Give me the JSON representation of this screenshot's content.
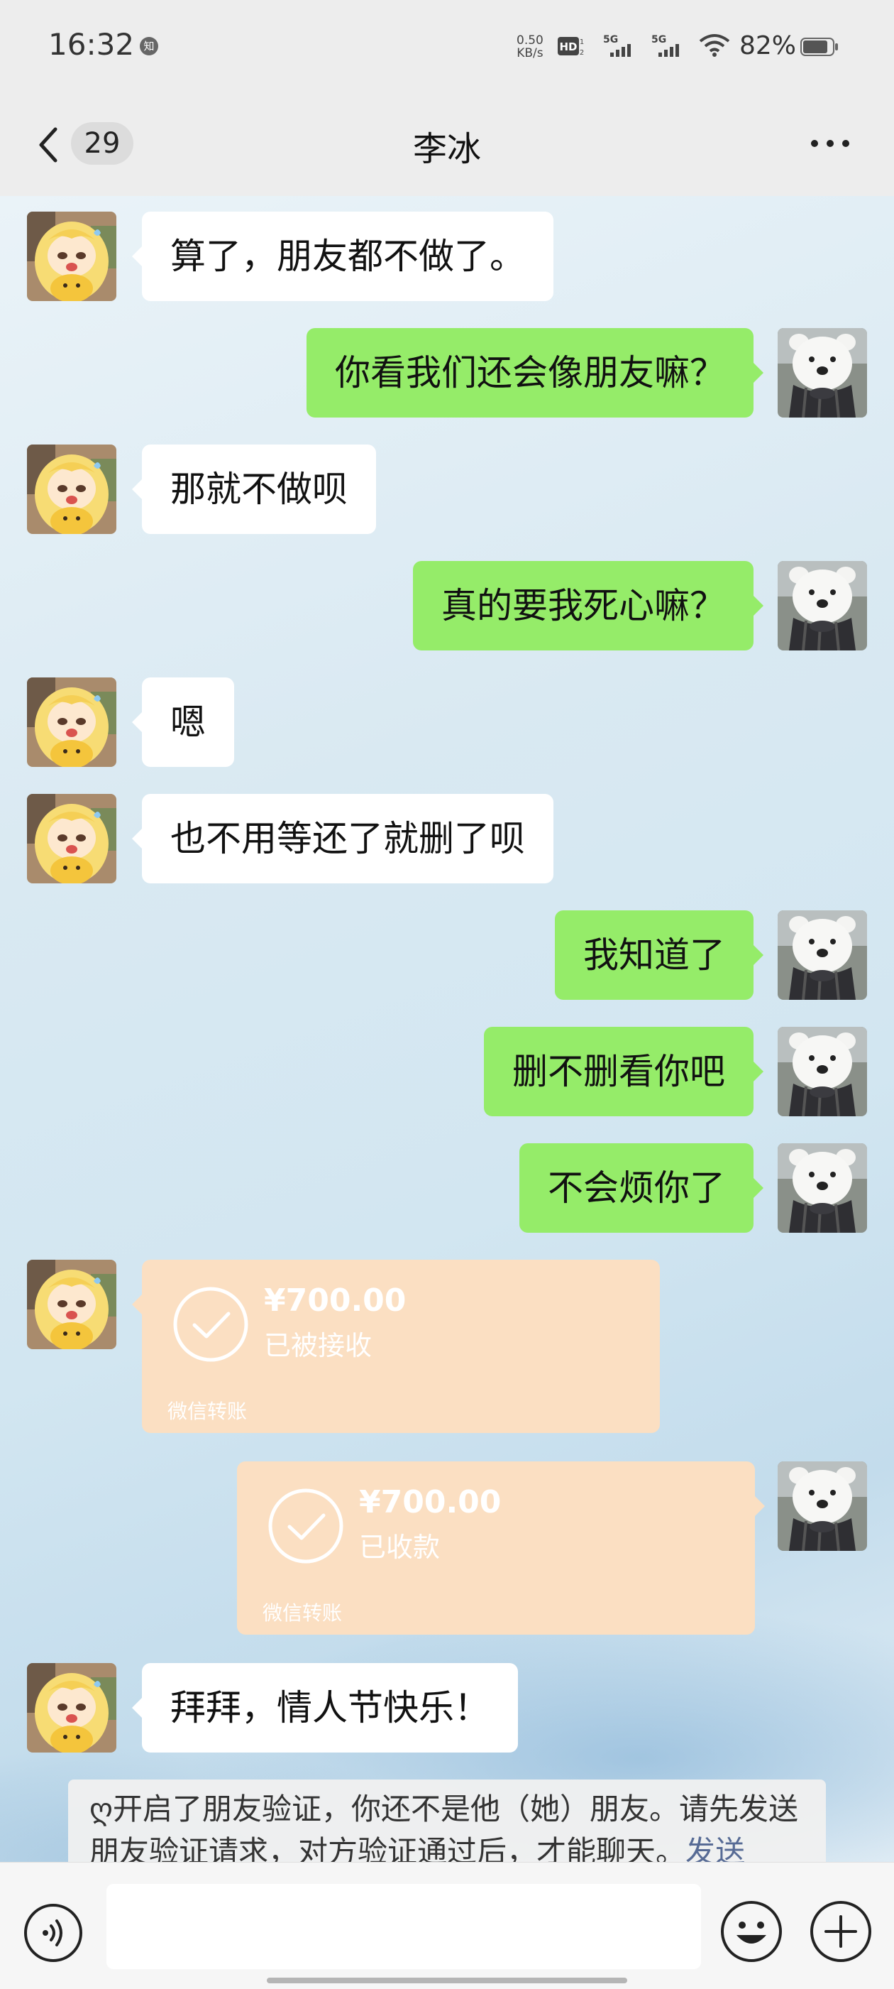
{
  "status_bar": {
    "time": "16:32",
    "notification_icon": "知",
    "net_speed_value": "0.50",
    "net_speed_unit": "KB/s",
    "hd_label": "HD",
    "sim1_label": "5G",
    "sim2_label": "5G",
    "battery_percent": "82%"
  },
  "nav": {
    "unread_count": "29",
    "title": "李冰",
    "more_icon": "ellipsis-icon"
  },
  "messages": [
    {
      "side": "left",
      "text": "算了，朋友都不做了。"
    },
    {
      "side": "right",
      "text": "你看我们还会像朋友嘛？"
    },
    {
      "side": "left",
      "text": "那就不做呗"
    },
    {
      "side": "right",
      "text": "真的要我死心嘛？"
    },
    {
      "side": "left",
      "text": "嗯"
    },
    {
      "side": "left",
      "text": "也不用等还了就删了呗"
    },
    {
      "side": "right",
      "text": "我知道了"
    },
    {
      "side": "right",
      "text": "删不删看你吧"
    },
    {
      "side": "right",
      "text": "不会烦你了"
    }
  ],
  "transfers": [
    {
      "side": "left",
      "amount": "¥700.00",
      "status": "已被接收",
      "label": "微信转账"
    },
    {
      "side": "right",
      "amount": "¥700.00",
      "status": "已收款",
      "label": "微信转账"
    }
  ],
  "last_message": {
    "side": "left",
    "text": "拜拜，情人节快乐！"
  },
  "system_note": {
    "text": "ღ开启了朋友验证，你还不是他（她）朋友。请先发送朋友验证请求，对方验证通过后，才能聊天。",
    "link": "发送"
  },
  "input_bar": {
    "voice_icon": "voice-icon",
    "emoji_icon": "emoji-icon",
    "plus_icon": "plus-icon",
    "input_value": ""
  },
  "colors": {
    "sent_bubble": "#95ec69",
    "received_bubble": "#ffffff",
    "transfer_bubble": "#fbdfc2",
    "link": "#576b95"
  }
}
